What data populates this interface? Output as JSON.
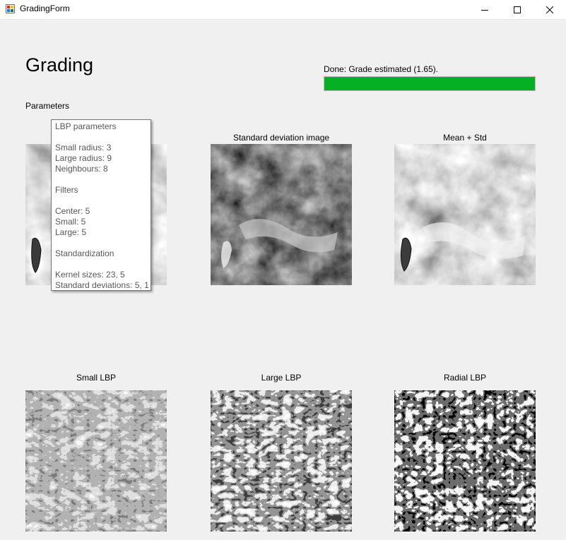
{
  "window": {
    "title": "GradingForm",
    "icon": "app-window-icon",
    "controls": [
      "minimize-icon",
      "maximize-icon",
      "close-icon"
    ]
  },
  "header": {
    "title": "Grading",
    "status": "Done: Grade estimated (1.65).",
    "progress": 1.0,
    "progress_color": "#06b025",
    "parameters_label": "Parameters"
  },
  "panels": {
    "mean": {
      "caption": ""
    },
    "std": {
      "caption": "Standard deviation image"
    },
    "mean_std": {
      "caption": "Mean + Std"
    },
    "small_lbp": {
      "caption": "Small LBP"
    },
    "large_lbp": {
      "caption": "Large LBP"
    },
    "radial_lbp": {
      "caption": "Radial LBP"
    }
  },
  "tooltip": {
    "lines": [
      "LBP parameters",
      "",
      "Small radius: 3",
      "Large radius: 9",
      "Neighbours: 8",
      "",
      "Filters",
      "",
      "Center: 5",
      "Small: 5",
      "Large: 5",
      "",
      "Standardization",
      "",
      "Kernel sizes: 23, 5",
      "Standard deviations: 5, 1"
    ]
  }
}
